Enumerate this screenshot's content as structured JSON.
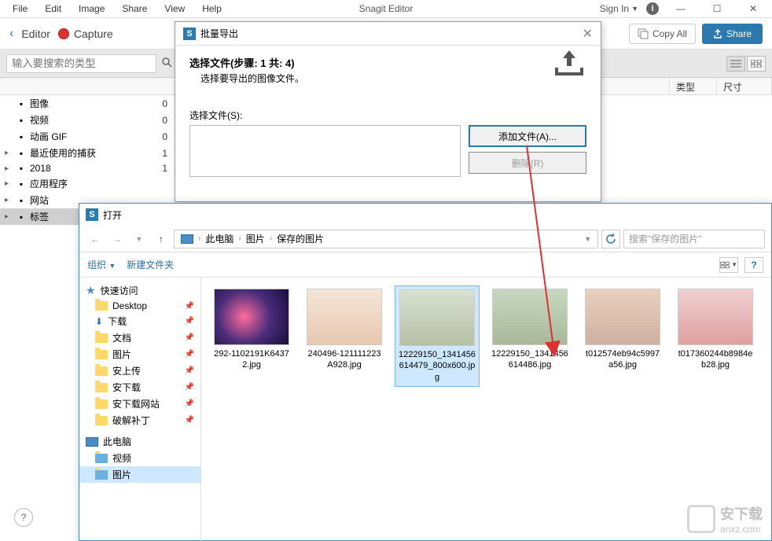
{
  "app": {
    "title": "Snagit Editor",
    "menu": [
      "File",
      "Edit",
      "Image",
      "Share",
      "View",
      "Help"
    ],
    "sign_in": "Sign In",
    "minimize": "—",
    "maximize": "☐",
    "close": "✕"
  },
  "toolbar": {
    "back": "‹",
    "editor": "Editor",
    "capture": "Capture",
    "copy_all": "Copy All",
    "share": "Share"
  },
  "search": {
    "placeholder": "输入要搜索的类型"
  },
  "columns": {
    "type": "类型",
    "size": "尺寸"
  },
  "library": [
    {
      "icon": "camera",
      "label": "图像",
      "count": "0",
      "expand": ""
    },
    {
      "icon": "video",
      "label": "视频",
      "count": "0",
      "expand": ""
    },
    {
      "icon": "video",
      "label": "动画 GIF",
      "count": "0",
      "expand": ""
    },
    {
      "icon": "clock",
      "label": "最近使用的捕获",
      "count": "1",
      "expand": "▸"
    },
    {
      "icon": "folder",
      "label": "2018",
      "count": "1",
      "expand": "▸"
    },
    {
      "icon": "app",
      "label": "应用程序",
      "count": "",
      "expand": "▸"
    },
    {
      "icon": "globe",
      "label": "网站",
      "count": "",
      "expand": "▸"
    },
    {
      "icon": "tag",
      "label": "标签",
      "count": "",
      "expand": "▸",
      "selected": true
    }
  ],
  "batch": {
    "title": "批量导出",
    "step": "选择文件(步骤: 1 共: 4)",
    "desc": "选择要导出的图像文件。",
    "select_label": "选择文件(S):",
    "add_btn": "添加文件(A)...",
    "delete_btn": "删除(R)"
  },
  "open": {
    "title": "打开",
    "breadcrumb": [
      "此电脑",
      "图片",
      "保存的图片"
    ],
    "search_placeholder": "搜索\"保存的图片\"",
    "organize": "组织",
    "new_folder": "新建文件夹",
    "nav": {
      "quick_access": "快速访问",
      "items": [
        "Desktop",
        "下载",
        "文档",
        "图片",
        "安上传",
        "安下载",
        "安下载网站",
        "破解补丁"
      ],
      "this_pc": "此电脑",
      "pc_items": [
        "视频",
        "图片"
      ]
    },
    "files": [
      {
        "name": "292-1102191K64372.jpg",
        "cls": "img1"
      },
      {
        "name": "240496-121111223A928.jpg",
        "cls": "img2"
      },
      {
        "name": "12229150_1341456614479_800x600.jpg",
        "cls": "img3",
        "selected": true
      },
      {
        "name": "12229150_1341456614486.jpg",
        "cls": "img4"
      },
      {
        "name": "t012574eb94c5997a56.jpg",
        "cls": "img5"
      },
      {
        "name": "t017360244b8984eb28.jpg",
        "cls": "img6"
      }
    ]
  },
  "watermark": {
    "text": "安下载",
    "url": "anxz.com"
  },
  "help": "?"
}
